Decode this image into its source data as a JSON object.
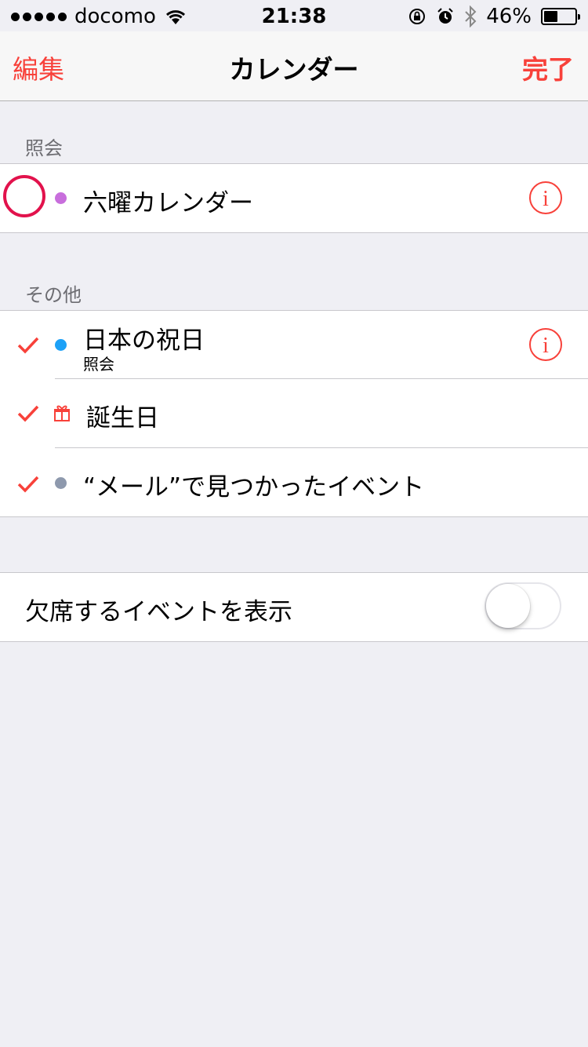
{
  "status_bar": {
    "carrier": "docomo",
    "time": "21:38",
    "battery_percent": "46%",
    "battery_level": 0.46,
    "icons": [
      "signal-dots",
      "wifi-icon",
      "rotation-lock-icon",
      "alarm-icon",
      "bluetooth-icon",
      "battery-icon"
    ]
  },
  "nav": {
    "left_label": "編集",
    "title": "カレンダー",
    "right_label": "完了",
    "accent_color": "#f8413a"
  },
  "sections": [
    {
      "header": "照会",
      "items": [
        {
          "label": "六曜カレンダー",
          "color": "#c86edc",
          "checked": false,
          "info": true
        }
      ]
    },
    {
      "header": "その他",
      "items": [
        {
          "label": "日本の祝日",
          "sublabel": "照会",
          "color": "#1da1f7",
          "checked": true,
          "info": true
        },
        {
          "label": "誕生日",
          "icon": "gift-icon",
          "checked": true,
          "info": false
        },
        {
          "label": "“メール”で見つかったイベント",
          "color": "#8e99ad",
          "checked": true,
          "info": false
        }
      ]
    }
  ],
  "toggle_row": {
    "label": "欠席するイベントを表示",
    "on": false
  }
}
